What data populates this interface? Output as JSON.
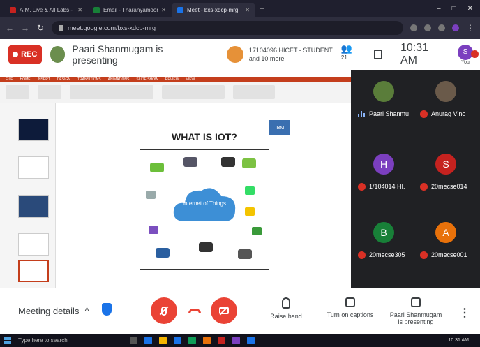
{
  "browser": {
    "tabs": [
      {
        "label": "A.M. Live & All Labs - Notes",
        "active": false,
        "color": "#c5221f"
      },
      {
        "label": "Email - Tharanyamoorthi -",
        "active": false,
        "color": "#188038"
      },
      {
        "label": "Meet - bxs-xdcp-mrg",
        "active": true,
        "color": "#1a73e8"
      }
    ],
    "url": "meet.google.com/bxs-xdcp-mrg",
    "window_controls": [
      "–",
      "□",
      "✕"
    ]
  },
  "meet": {
    "rec_label": "REC",
    "presenter_text": "Paari Shanmugam is presenting",
    "student_text": "17104096 HICET - STUDENT ... and 10 more",
    "people_count": "21",
    "time": "10:31 AM",
    "you_initial": "S",
    "you_label": "You"
  },
  "shared_screen": {
    "slide_title": "WHAT IS IOT?",
    "ibm_label": "IBM",
    "cloud_label": "Internet of Things",
    "ppt_tabs": [
      "FILE",
      "HOME",
      "INSERT",
      "DESIGN",
      "TRANSITIONS",
      "ANIMATIONS",
      "SLIDE SHOW",
      "REVIEW",
      "VIEW"
    ]
  },
  "tiles": [
    {
      "name": "Paari Shanmu",
      "initial": "",
      "color": "#5a7d3a",
      "speaking": true
    },
    {
      "name": "Anurag Vino",
      "initial": "",
      "color": "#6a5a4a",
      "speaking": false
    },
    {
      "name": "1/104014 HI.",
      "initial": "H",
      "color": "#7b3fbf",
      "speaking": false
    },
    {
      "name": "20mecse014",
      "initial": "S",
      "color": "#c5221f",
      "speaking": false
    },
    {
      "name": "20mecse305",
      "initial": "B",
      "color": "#188038",
      "speaking": false
    },
    {
      "name": "20mecse001",
      "initial": "A",
      "color": "#e8710a",
      "speaking": false
    }
  ],
  "controls": {
    "meeting_details": "Meeting details",
    "raise_hand": "Raise hand",
    "captions": "Turn on captions",
    "presenting": "Paari Shanmugam is presenting",
    "more": "⋮"
  },
  "taskbar": {
    "search_placeholder": "Type here to search",
    "time": "10:31 AM",
    "date": "",
    "icon_colors": [
      "#1a73e8",
      "#f4b400",
      "#1a73e8",
      "#0f9d58",
      "#e8710a",
      "#c5221f",
      "#7b3fbf",
      "#1a73e8"
    ]
  }
}
